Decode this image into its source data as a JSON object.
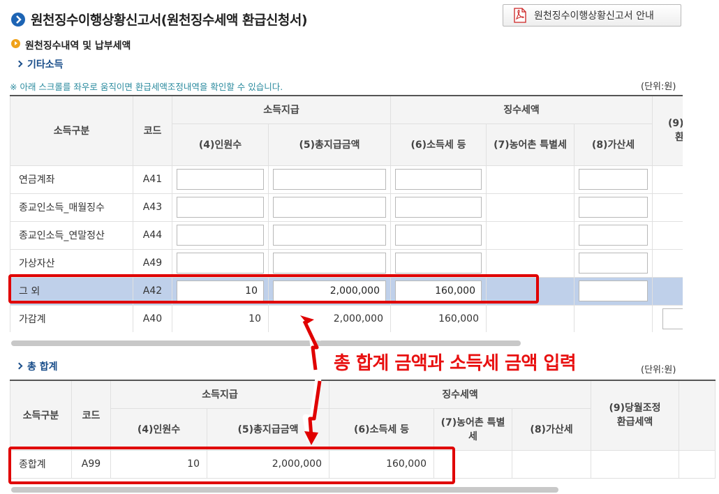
{
  "header": {
    "title": "원천징수이행상황신고서(원천징수세액 환급신청서)",
    "guide_button_label": "원천징수이행상황신고서 안내"
  },
  "section": {
    "subtitle": "원천징수내역 및 납부세액",
    "link_other": "기타소득",
    "note": "※ 아래 스크롤를 좌우로 움직이면 환급세액조정내역을 확인할 수 있습니다.",
    "unit": "(단위:원)",
    "link_total": "총 합계",
    "unit2": "(단위:원)"
  },
  "table1": {
    "headers": {
      "category": "소득구분",
      "code": "코드",
      "income_group": "소득지급",
      "tax_group": "징수세액",
      "people": "(4)인원수",
      "total_paid": "(5)총지급금액",
      "income_tax": "(6)소득세 등",
      "rural_tax": "(7)농어촌 특별세",
      "penalty": "(8)가산세",
      "refund_partial_1": "(9)",
      "refund_partial_2": "환"
    },
    "rows": [
      {
        "name": "연금계좌",
        "code": "A41",
        "people": "",
        "total": "",
        "tax": "",
        "penalty": ""
      },
      {
        "name": "종교인소득_매월징수",
        "code": "A43",
        "people": "",
        "total": "",
        "tax": "",
        "penalty": ""
      },
      {
        "name": "종교인소득_연말정산",
        "code": "A44",
        "people": "",
        "total": "",
        "tax": "",
        "penalty": ""
      },
      {
        "name": "가상자산",
        "code": "A49",
        "people": "",
        "total": "",
        "tax": "",
        "penalty": ""
      },
      {
        "name": "그 외",
        "code": "A42",
        "people": "10",
        "total": "2,000,000",
        "tax": "160,000",
        "penalty": ""
      },
      {
        "name": "가감계",
        "code": "A40",
        "people": "10",
        "total": "2,000,000",
        "tax": "160,000",
        "penalty": ""
      }
    ]
  },
  "table2": {
    "headers": {
      "category": "소득구분",
      "code": "코드",
      "income_group": "소득지급",
      "tax_group": "징수세액",
      "people": "(4)인원수",
      "total_paid": "(5)총지급금액",
      "income_tax": "(6)소득세 등",
      "rural_tax": "(7)농어촌 특별세",
      "penalty": "(8)가산세",
      "refund": "(9)당월조정 환급세액"
    },
    "row": {
      "name": "종합계",
      "code": "A99",
      "people": "10",
      "total": "2,000,000",
      "tax": "160,000"
    }
  },
  "annotation": {
    "text": "총 합계 금액과 소득세 금액 입력"
  },
  "colors": {
    "accent_blue": "#1d64b4",
    "highlight_row": "#bfd0ea",
    "annotation_red": "#e00000",
    "note_teal": "#2a8a9e"
  },
  "icons": {
    "title": "circle-arrow-icon",
    "guide": "pdf-icon",
    "subtitle": "orange-bullet-icon",
    "links": "chevron-right-icon"
  }
}
